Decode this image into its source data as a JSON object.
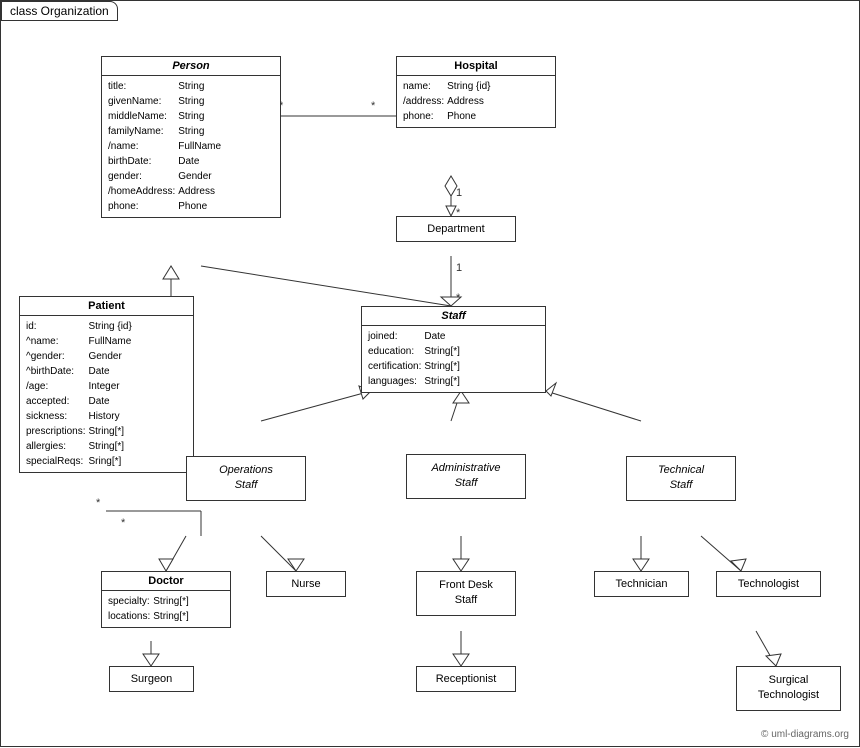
{
  "diagram": {
    "title": "class Organization",
    "copyright": "© uml-diagrams.org",
    "classes": {
      "person": {
        "name": "Person",
        "italic": true,
        "attributes": [
          [
            "title:",
            "String"
          ],
          [
            "givenName:",
            "String"
          ],
          [
            "middleName:",
            "String"
          ],
          [
            "familyName:",
            "String"
          ],
          [
            "/name:",
            "FullName"
          ],
          [
            "birthDate:",
            "Date"
          ],
          [
            "gender:",
            "Gender"
          ],
          [
            "/homeAddress:",
            "Address"
          ],
          [
            "phone:",
            "Phone"
          ]
        ]
      },
      "hospital": {
        "name": "Hospital",
        "italic": false,
        "attributes": [
          [
            "name:",
            "String {id}"
          ],
          [
            "/address:",
            "Address"
          ],
          [
            "phone:",
            "Phone"
          ]
        ]
      },
      "patient": {
        "name": "Patient",
        "italic": false,
        "attributes": [
          [
            "id:",
            "String {id}"
          ],
          [
            "^name:",
            "FullName"
          ],
          [
            "^gender:",
            "Gender"
          ],
          [
            "^birthDate:",
            "Date"
          ],
          [
            "/age:",
            "Integer"
          ],
          [
            "accepted:",
            "Date"
          ],
          [
            "sickness:",
            "History"
          ],
          [
            "prescriptions:",
            "String[*]"
          ],
          [
            "allergies:",
            "String[*]"
          ],
          [
            "specialReqs:",
            "Sring[*]"
          ]
        ]
      },
      "department": {
        "name": "Department",
        "italic": false
      },
      "staff": {
        "name": "Staff",
        "italic": true,
        "attributes": [
          [
            "joined:",
            "Date"
          ],
          [
            "education:",
            "String[*]"
          ],
          [
            "certification:",
            "String[*]"
          ],
          [
            "languages:",
            "String[*]"
          ]
        ]
      },
      "ops_staff": {
        "name": "Operations\nStaff",
        "italic": true
      },
      "admin_staff": {
        "name": "Administrative\nStaff",
        "italic": true
      },
      "tech_staff": {
        "name": "Technical\nStaff",
        "italic": true
      },
      "doctor": {
        "name": "Doctor",
        "italic": false,
        "attributes": [
          [
            "specialty:",
            "String[*]"
          ],
          [
            "locations:",
            "String[*]"
          ]
        ]
      },
      "nurse": {
        "name": "Nurse",
        "italic": false
      },
      "front_desk": {
        "name": "Front Desk\nStaff",
        "italic": false
      },
      "technician": {
        "name": "Technician",
        "italic": false
      },
      "technologist": {
        "name": "Technologist",
        "italic": false
      },
      "surgeon": {
        "name": "Surgeon",
        "italic": false
      },
      "receptionist": {
        "name": "Receptionist",
        "italic": false
      },
      "surgical_tech": {
        "name": "Surgical\nTechnologist",
        "italic": false
      }
    }
  }
}
